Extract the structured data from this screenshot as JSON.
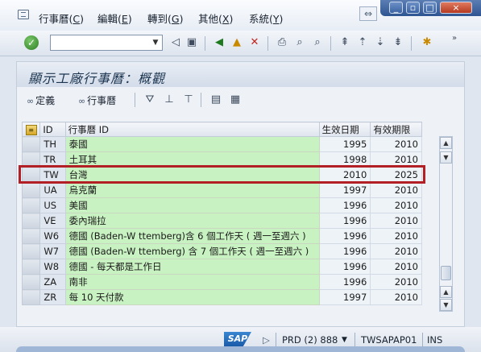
{
  "menu": {
    "items": [
      {
        "label": "行事曆",
        "key": "C"
      },
      {
        "label": "編輯",
        "key": "E"
      },
      {
        "label": "轉到",
        "key": "G"
      },
      {
        "label": "其他",
        "key": "X"
      },
      {
        "label": "系統",
        "key": "Y"
      }
    ]
  },
  "title": "顯示工廠行事曆：概觀",
  "app_toolbar": {
    "definition_label": "定義",
    "calendar_label": "行事曆"
  },
  "grid": {
    "columns": [
      "ID",
      "行事曆 ID",
      "生效日期",
      "有效期限"
    ],
    "rows": [
      {
        "id": "TH",
        "name": "泰國",
        "from": "1995",
        "to": "2010"
      },
      {
        "id": "TR",
        "name": "土耳其",
        "from": "1998",
        "to": "2010"
      },
      {
        "id": "TW",
        "name": "台灣",
        "from": "2010",
        "to": "2025"
      },
      {
        "id": "UA",
        "name": "烏克蘭",
        "from": "1997",
        "to": "2010"
      },
      {
        "id": "US",
        "name": "美國",
        "from": "1996",
        "to": "2010"
      },
      {
        "id": "VE",
        "name": "委內瑞拉",
        "from": "1996",
        "to": "2010"
      },
      {
        "id": "W6",
        "name": "德國 (Baden-W   ttemberg)含 6 個工作天 ( 週一至週六 )",
        "from": "1996",
        "to": "2010"
      },
      {
        "id": "W7",
        "name": "德國 (Baden-W   ttemberg) 含 7 個工作天 ( 週一至週六 )",
        "from": "1996",
        "to": "2010"
      },
      {
        "id": "W8",
        "name": "德國 - 每天都是工作日",
        "from": "1996",
        "to": "2010"
      },
      {
        "id": "ZA",
        "name": "南非",
        "from": "1996",
        "to": "2010"
      },
      {
        "id": "ZR",
        "name": "每 10 天付款",
        "from": "1997",
        "to": "2010"
      }
    ]
  },
  "status": {
    "sap_logo": "SAP",
    "system": "PRD (2) 888",
    "server": "TWSAPAP01",
    "mode": "INS"
  },
  "colors": {
    "highlight_border": "#b21f24",
    "text_cell_bg": "#c9f2c2"
  }
}
